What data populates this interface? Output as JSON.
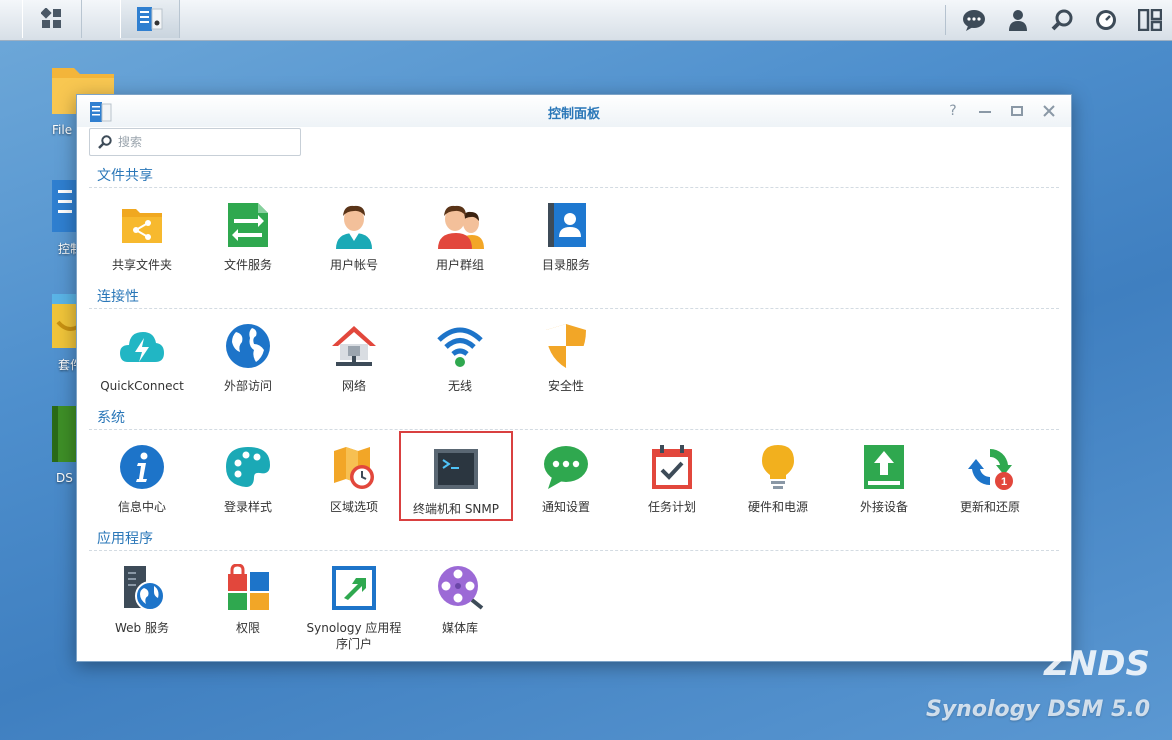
{
  "desktop": {
    "icons": [
      {
        "label": "File"
      },
      {
        "label": "控制"
      },
      {
        "label": "套件"
      },
      {
        "label": "DS"
      }
    ]
  },
  "window": {
    "title": "控制面板",
    "help": "?",
    "search_placeholder": "搜索"
  },
  "sections": [
    {
      "title": "文件共享",
      "items": [
        {
          "label": "共享文件夹",
          "icon": "shared-folder-icon"
        },
        {
          "label": "文件服务",
          "icon": "file-services-icon"
        },
        {
          "label": "用户帐号",
          "icon": "user-icon"
        },
        {
          "label": "用户群组",
          "icon": "group-icon"
        },
        {
          "label": "目录服务",
          "icon": "directory-icon"
        }
      ]
    },
    {
      "title": "连接性",
      "items": [
        {
          "label": "QuickConnect",
          "icon": "quickconnect-icon"
        },
        {
          "label": "外部访问",
          "icon": "globe-icon"
        },
        {
          "label": "网络",
          "icon": "network-icon"
        },
        {
          "label": "无线",
          "icon": "wifi-icon"
        },
        {
          "label": "安全性",
          "icon": "shield-icon"
        }
      ]
    },
    {
      "title": "系统",
      "items": [
        {
          "label": "信息中心",
          "icon": "info-icon"
        },
        {
          "label": "登录样式",
          "icon": "palette-icon"
        },
        {
          "label": "区域选项",
          "icon": "regional-icon"
        },
        {
          "label": "终端机和 SNMP",
          "icon": "terminal-icon"
        },
        {
          "label": "通知设置",
          "icon": "chat-icon"
        },
        {
          "label": "任务计划",
          "icon": "calendar-icon"
        },
        {
          "label": "硬件和电源",
          "icon": "bulb-icon"
        },
        {
          "label": "外接设备",
          "icon": "external-device-icon"
        },
        {
          "label": "更新和还原",
          "icon": "update-icon",
          "badge": "1"
        }
      ]
    },
    {
      "title": "应用程序",
      "items": [
        {
          "label": "Web 服务",
          "icon": "web-services-icon"
        },
        {
          "label": "权限",
          "icon": "privileges-icon"
        },
        {
          "label": "Synology 应用程序门户",
          "icon": "app-portal-icon"
        },
        {
          "label": "媒体库",
          "icon": "media-library-icon"
        }
      ]
    }
  ],
  "watermark": {
    "line1": "ZNDS",
    "line2": "Synology DSM 5.0"
  }
}
